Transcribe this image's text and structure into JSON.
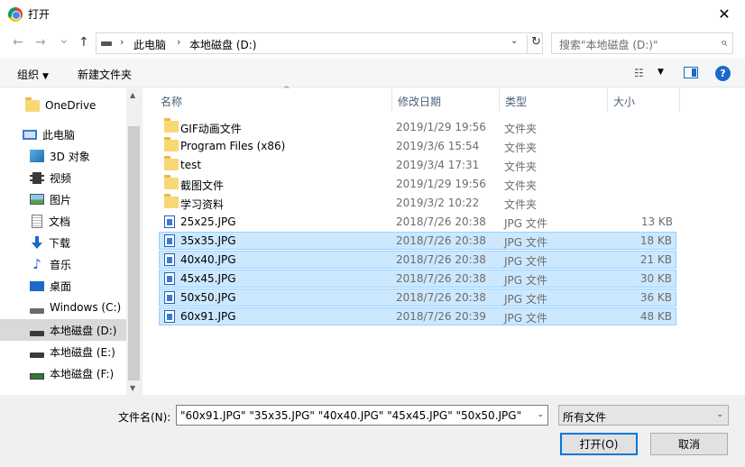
{
  "window": {
    "title": "打开",
    "close_glyph": "✕"
  },
  "nav": {
    "back": "←",
    "forward": "→",
    "history": "⌄",
    "up": "↑",
    "breadcrumb": [
      "此电脑",
      "本地磁盘 (D:)"
    ],
    "breadcrumb_sep": "›",
    "dropdown_glyph": "⌄",
    "refresh_glyph": "↻"
  },
  "search": {
    "placeholder": "搜索\"本地磁盘 (D:)\"",
    "glyph": "⌕"
  },
  "toolbar": {
    "organize": "组织",
    "new_folder": "新建文件夹",
    "caret": "▼",
    "view_glyph": "☷",
    "help": "?"
  },
  "sidebar": {
    "items": [
      {
        "label": "OneDrive",
        "icon": "folder-icon"
      },
      {
        "label": "此电脑",
        "icon": "computer-icon"
      },
      {
        "label": "3D 对象",
        "icon": "3d-objects-icon"
      },
      {
        "label": "视频",
        "icon": "video-icon"
      },
      {
        "label": "图片",
        "icon": "pictures-icon"
      },
      {
        "label": "文档",
        "icon": "documents-icon"
      },
      {
        "label": "下载",
        "icon": "download-icon"
      },
      {
        "label": "音乐",
        "icon": "music-icon"
      },
      {
        "label": "桌面",
        "icon": "desktop-icon"
      },
      {
        "label": "Windows (C:)",
        "icon": "drive-icon"
      },
      {
        "label": "本地磁盘 (D:)",
        "icon": "drive-icon"
      },
      {
        "label": "本地磁盘 (E:)",
        "icon": "drive-icon"
      },
      {
        "label": "本地磁盘 (F:)",
        "icon": "network-drive-icon"
      }
    ],
    "scroll_up": "▲",
    "scroll_down": "▼",
    "music_glyph": "♪"
  },
  "files": {
    "headers": {
      "name": "名称",
      "date": "修改日期",
      "type": "类型",
      "size": "大小",
      "sort_caret": "^"
    },
    "rows": [
      {
        "name": "GIF动画文件",
        "date": "2019/1/29 19:56",
        "type": "文件夹",
        "size": ""
      },
      {
        "name": "Program Files (x86)",
        "date": "2019/3/6 15:54",
        "type": "文件夹",
        "size": ""
      },
      {
        "name": "test",
        "date": "2019/3/4 17:31",
        "type": "文件夹",
        "size": ""
      },
      {
        "name": "截图文件",
        "date": "2019/1/29 19:56",
        "type": "文件夹",
        "size": ""
      },
      {
        "name": "学习资料",
        "date": "2019/3/2 10:22",
        "type": "文件夹",
        "size": ""
      },
      {
        "name": "25x25.JPG",
        "date": "2018/7/26 20:38",
        "type": "JPG 文件",
        "size": "13 KB"
      },
      {
        "name": "35x35.JPG",
        "date": "2018/7/26 20:38",
        "type": "JPG 文件",
        "size": "18 KB"
      },
      {
        "name": "40x40.JPG",
        "date": "2018/7/26 20:38",
        "type": "JPG 文件",
        "size": "21 KB"
      },
      {
        "name": "45x45.JPG",
        "date": "2018/7/26 20:38",
        "type": "JPG 文件",
        "size": "30 KB"
      },
      {
        "name": "50x50.JPG",
        "date": "2018/7/26 20:38",
        "type": "JPG 文件",
        "size": "36 KB"
      },
      {
        "name": "60x91.JPG",
        "date": "2018/7/26 20:39",
        "type": "JPG 文件",
        "size": "48 KB"
      }
    ]
  },
  "footer": {
    "filename_label": "文件名(N):",
    "filename_value": "\"60x91.JPG\" \"35x35.JPG\" \"40x40.JPG\" \"45x45.JPG\" \"50x50.JPG\"",
    "filetype_value": "所有文件",
    "open_label": "打开(O)",
    "cancel_label": "取消",
    "dropdown_glyph": "⌄"
  },
  "colors": {
    "selection": "#cce8ff",
    "selection_border": "#99d1ff",
    "accent": "#0078d7"
  }
}
